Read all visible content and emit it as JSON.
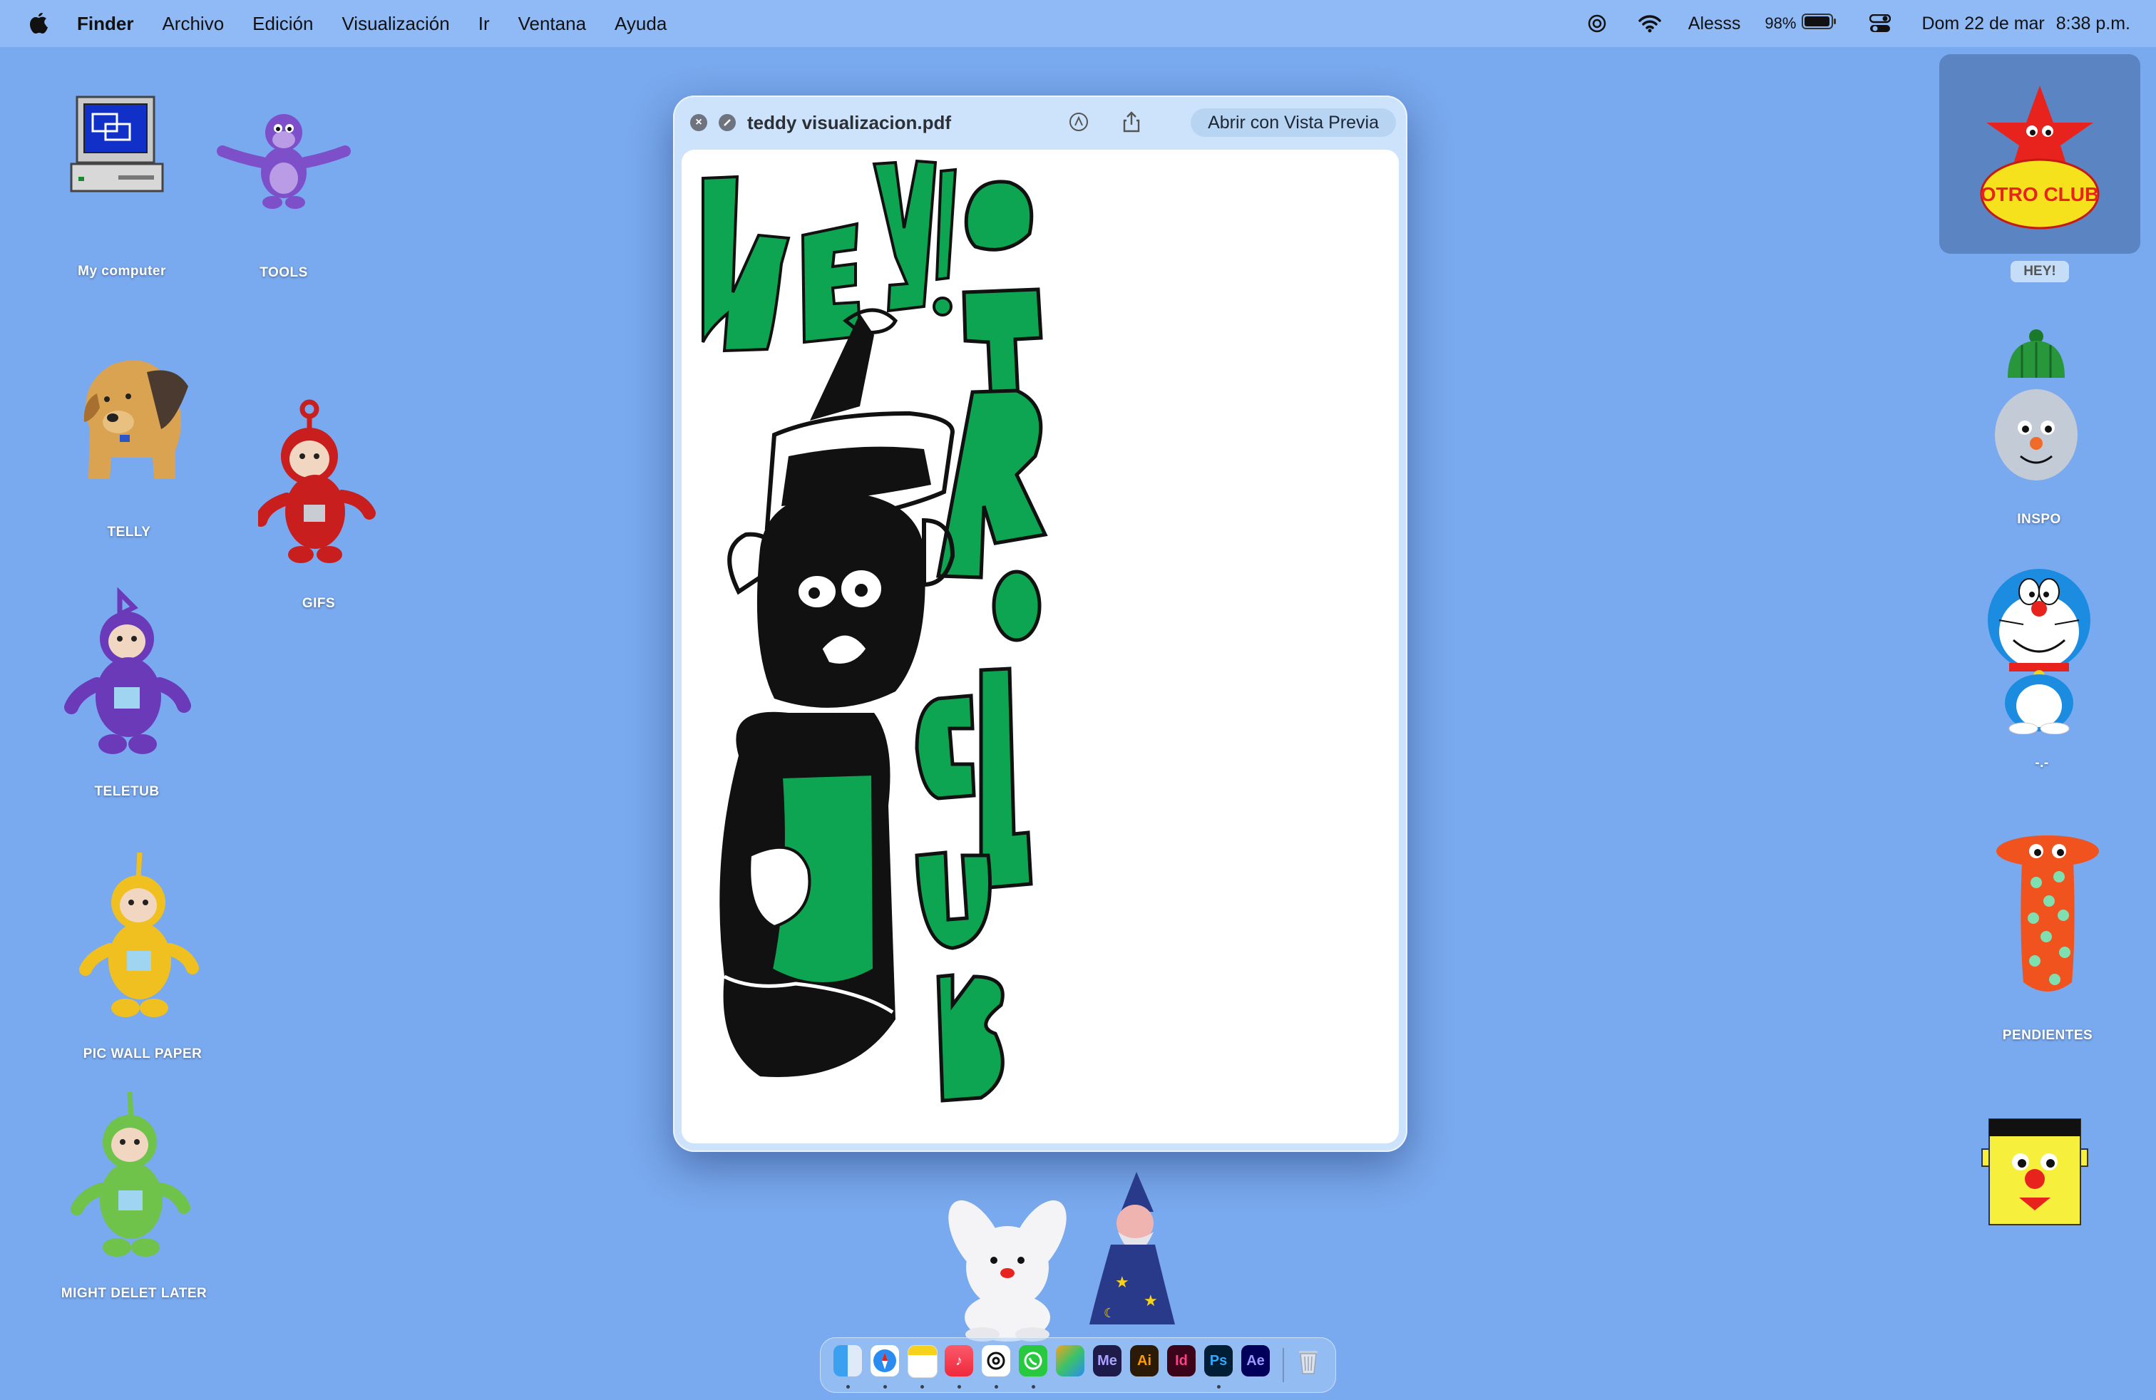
{
  "menubar": {
    "app_name": "Finder",
    "items": [
      "Archivo",
      "Edición",
      "Visualización",
      "Ir",
      "Ventana",
      "Ayuda"
    ],
    "status": {
      "user": "Alesss",
      "battery": "98%",
      "date": "Dom 22 de mar",
      "time": "8:38 p.m."
    }
  },
  "desktop_icons": {
    "my_computer": "My computer",
    "tools": "TOOLS",
    "telly": "TELLY",
    "gifs": "GIFS",
    "teletub": "TELETUB",
    "pic_wall_paper": "PIC WALL PAPER",
    "might_delet_later": "MIGHT DELET LATER",
    "hey": "HEY!",
    "inspo": "INSPO",
    "dash": "-.-",
    "pendientes": "PENDIENTES"
  },
  "hey_icon_text": "OTRO CLUB",
  "quicklook": {
    "title": "teddy visualizacion.pdf",
    "open_button": "Abrir con Vista Previa"
  },
  "dock": {
    "apps": [
      "finder",
      "safari",
      "notes",
      "music",
      "chatgpt",
      "whatsapp",
      "office",
      "Me",
      "Ai",
      "Id",
      "Ps",
      "Ae",
      "trash"
    ],
    "labels": {
      "me": "Me",
      "ai": "Ai",
      "id": "Id",
      "ps": "Ps",
      "ae": "Ae"
    }
  },
  "colors": {
    "desktop": "#79a9ee",
    "menubar": "#8fbaf6",
    "drawing_green": "#0ea552"
  }
}
